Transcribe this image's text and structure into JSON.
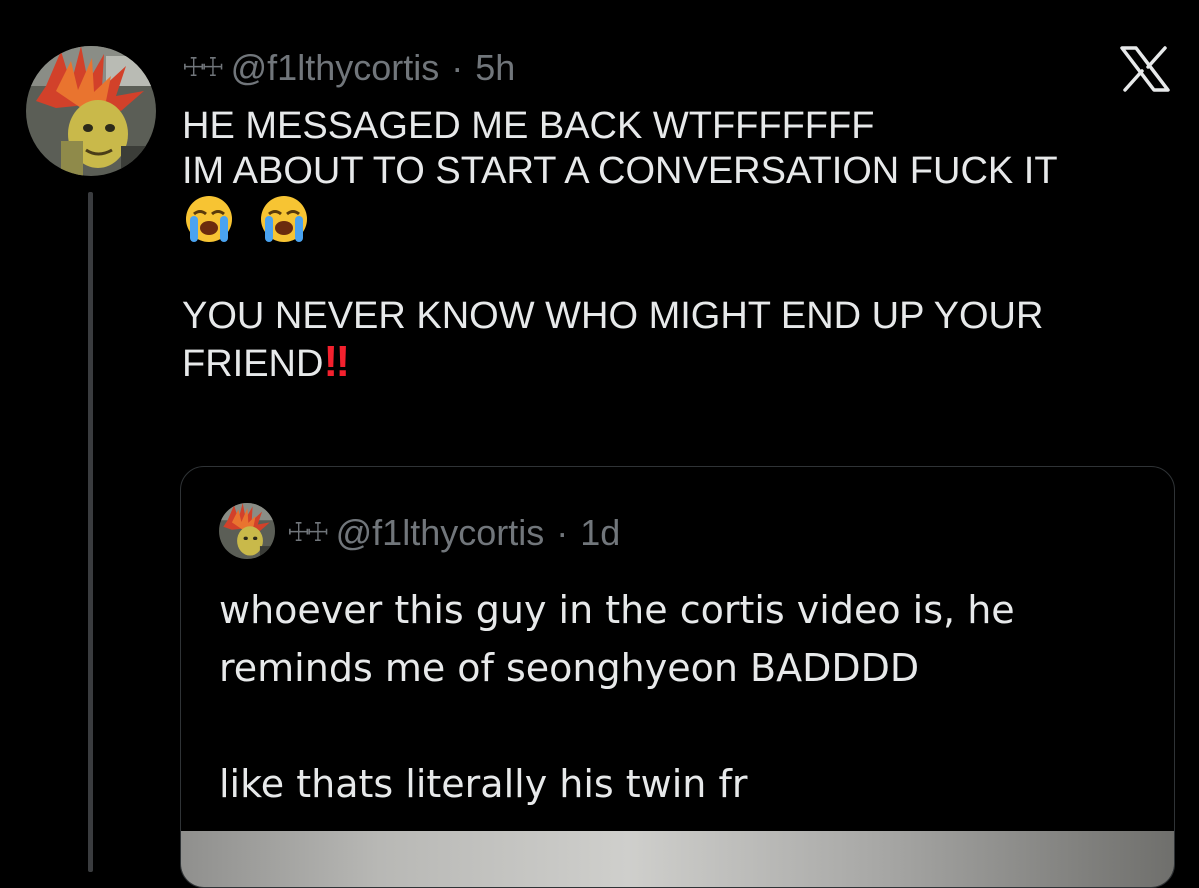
{
  "tweet": {
    "author_glyph": "☩☩",
    "handle": "@f1lthycortis",
    "separator": "·",
    "time": "5h",
    "lines": [
      "HE MESSAGED ME BACK WTFFFFFFF",
      "IM ABOUT TO START A CONVERSATION FUCK IT",
      "",
      "",
      "YOU NEVER KNOW WHO MIGHT END UP YOUR",
      "FRIEND"
    ],
    "emojis": [
      "loudly-crying-face",
      "loudly-crying-face"
    ],
    "exclamation": "‼"
  },
  "quoted_tweet": {
    "author_glyph": "☩☩",
    "handle": "@f1lthycortis",
    "separator": "·",
    "time": "1d",
    "lines": [
      "whoever this guy in the cortis video is, he",
      "reminds me of seonghyeon BADDDD",
      "",
      "like thats literally his twin fr"
    ]
  },
  "icons": {
    "close": "x-logo-icon",
    "avatar": "profile-avatar"
  },
  "colors": {
    "background": "#000000",
    "text": "#e7e9ea",
    "muted": "#71767b",
    "border": "#2f3336",
    "accent_red": "#f4212e"
  }
}
